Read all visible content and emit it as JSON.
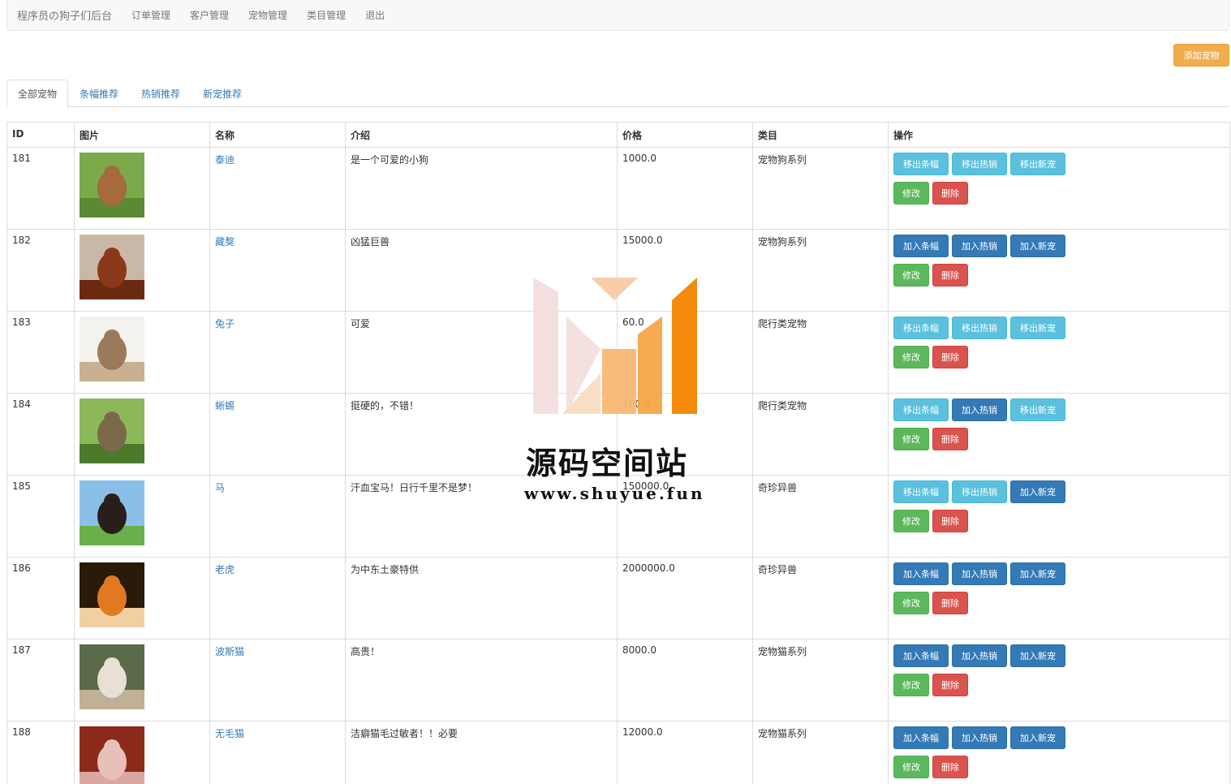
{
  "navbar": {
    "brand": "程序员の狗子们后台",
    "links": [
      "订单管理",
      "客户管理",
      "宠物管理",
      "类目管理",
      "退出"
    ]
  },
  "add_button": "添加宠物",
  "tabs": [
    {
      "label": "全部宠物",
      "active": true
    },
    {
      "label": "条幅推荐",
      "active": false
    },
    {
      "label": "热销推荐",
      "active": false
    },
    {
      "label": "新宠推荐",
      "active": false
    }
  ],
  "table": {
    "headers": [
      "ID",
      "图片",
      "名称",
      "介绍",
      "价格",
      "类目",
      "操作"
    ],
    "rows": [
      {
        "id": "181",
        "name": "泰迪",
        "intro": "是一个可爱的小狗",
        "price": "1000.0",
        "category": "宠物狗系列",
        "banner": "移出条幅",
        "hot": "移出热销",
        "new": "移出新宠",
        "banner_in": true,
        "hot_in": true,
        "new_in": true,
        "image": "teddy-dog"
      },
      {
        "id": "182",
        "name": "藏獒",
        "intro": "凶猛巨兽",
        "price": "15000.0",
        "category": "宠物狗系列",
        "banner": "加入条幅",
        "hot": "加入热销",
        "new": "加入新宠",
        "banner_in": false,
        "hot_in": false,
        "new_in": false,
        "image": "tibetan-mastiff"
      },
      {
        "id": "183",
        "name": "兔子",
        "intro": "可爱",
        "price": "60.0",
        "category": "爬行类宠物",
        "banner": "移出条幅",
        "hot": "移出热销",
        "new": "移出新宠",
        "banner_in": true,
        "hot_in": true,
        "new_in": true,
        "image": "rabbit"
      },
      {
        "id": "184",
        "name": "蜥蜴",
        "intro": "挺硬的，不错！",
        "price": "100.0",
        "category": "爬行类宠物",
        "banner": "移出条幅",
        "hot": "加入热销",
        "new": "移出新宠",
        "banner_in": true,
        "hot_in": false,
        "new_in": true,
        "image": "lizard"
      },
      {
        "id": "185",
        "name": "马",
        "intro": "汗血宝马！日行千里不是梦！",
        "price": "150000.0",
        "category": "奇珍异兽",
        "banner": "移出条幅",
        "hot": "移出热销",
        "new": "加入新宠",
        "banner_in": true,
        "hot_in": true,
        "new_in": false,
        "image": "horse"
      },
      {
        "id": "186",
        "name": "老虎",
        "intro": "为中东土豪特供",
        "price": "2000000.0",
        "category": "奇珍异兽",
        "banner": "加入条幅",
        "hot": "加入热销",
        "new": "加入新宠",
        "banner_in": false,
        "hot_in": false,
        "new_in": false,
        "image": "tiger"
      },
      {
        "id": "187",
        "name": "波斯猫",
        "intro": "高贵！",
        "price": "8000.0",
        "category": "宠物猫系列",
        "banner": "加入条幅",
        "hot": "加入热销",
        "new": "加入新宠",
        "banner_in": false,
        "hot_in": false,
        "new_in": false,
        "image": "persian-cat"
      },
      {
        "id": "188",
        "name": "无毛猫",
        "intro": "洁癖猫毛过敏者！！必要",
        "price": "12000.0",
        "category": "宠物猫系列",
        "banner": "加入条幅",
        "hot": "加入热销",
        "new": "加入新宠",
        "banner_in": false,
        "hot_in": false,
        "new_in": false,
        "image": "sphynx-cat"
      }
    ],
    "edit_label": "修改",
    "delete_label": "删除"
  },
  "watermark": {
    "title": "源码空间站",
    "url": "www.shuyue.fun"
  },
  "colors": {
    "info": "#5bc0de",
    "primary": "#337ab7",
    "success": "#5cb85c",
    "danger": "#d9534f",
    "warning": "#f0ad4e"
  }
}
